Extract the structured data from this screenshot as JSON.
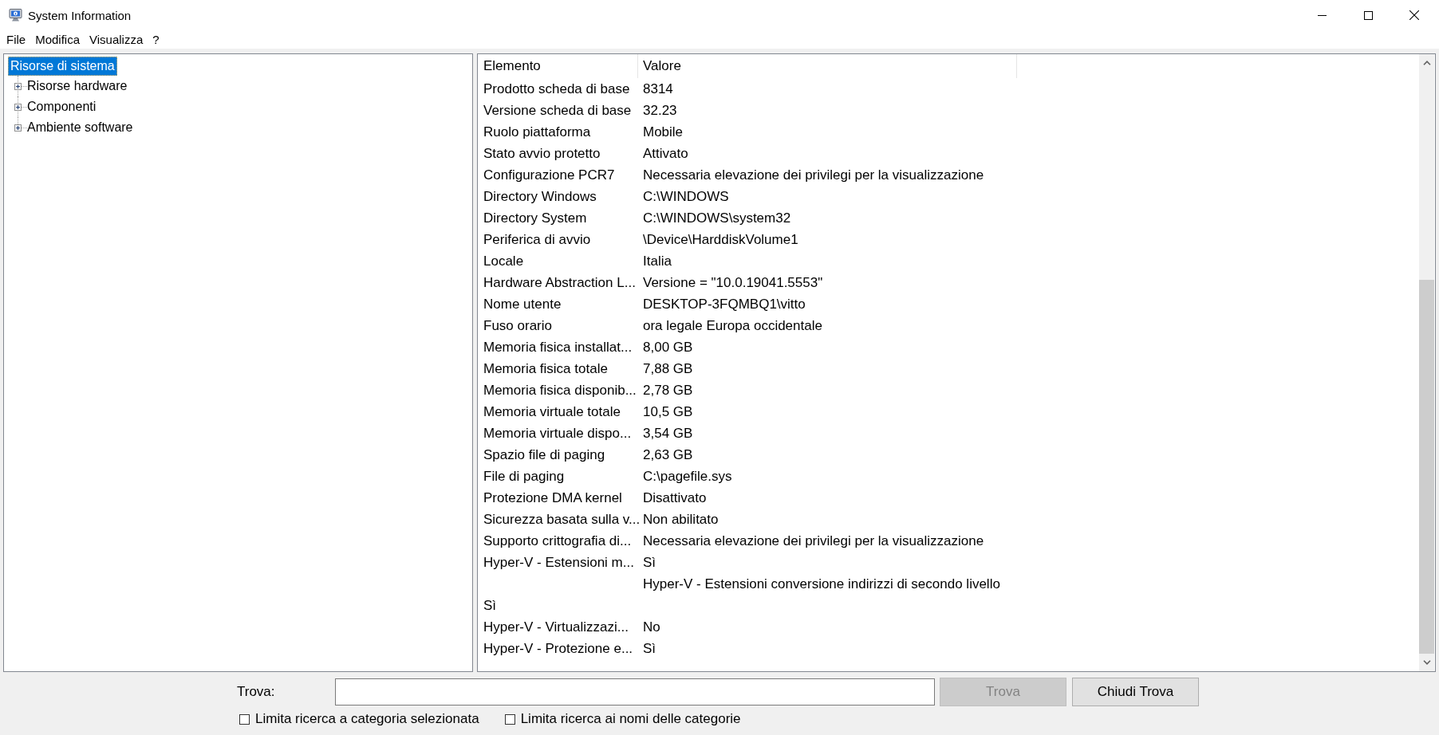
{
  "window": {
    "title": "System Information"
  },
  "menu": [
    "File",
    "Modifica",
    "Visualizza",
    "?"
  ],
  "tree": {
    "label": "Risorse di sistema",
    "selected": true,
    "children": [
      {
        "label": "Risorse hardware",
        "expanded": false,
        "selected": false
      },
      {
        "label": "Componenti",
        "expanded": false,
        "selected": false
      },
      {
        "label": "Ambiente software",
        "expanded": false,
        "selected": false
      }
    ]
  },
  "table": {
    "columns": [
      "Elemento",
      "Valore"
    ],
    "rows": [
      {
        "element": "Prodotto scheda di base",
        "value": "8314"
      },
      {
        "element": "Versione scheda di base",
        "value": "32.23"
      },
      {
        "element": "Ruolo piattaforma",
        "value": "Mobile"
      },
      {
        "element": "Stato avvio protetto",
        "value": "Attivato"
      },
      {
        "element": "Configurazione PCR7",
        "value": "Necessaria elevazione dei privilegi per la visualizzazione"
      },
      {
        "element": "Directory Windows",
        "value": "C:\\WINDOWS"
      },
      {
        "element": "Directory System",
        "value": "C:\\WINDOWS\\system32"
      },
      {
        "element": "Periferica di avvio",
        "value": "\\Device\\HarddiskVolume1"
      },
      {
        "element": "Locale",
        "value": "Italia"
      },
      {
        "element": "Hardware Abstraction L...",
        "value": "Versione = \"10.0.19041.5553\""
      },
      {
        "element": "Nome utente",
        "value": "DESKTOP-3FQMBQ1\\vitto"
      },
      {
        "element": "Fuso orario",
        "value": "ora legale Europa occidentale"
      },
      {
        "element": "Memoria fisica installat...",
        "value": "8,00 GB"
      },
      {
        "element": "Memoria fisica totale",
        "value": "7,88 GB"
      },
      {
        "element": "Memoria fisica disponib...",
        "value": "2,78 GB"
      },
      {
        "element": "Memoria virtuale totale",
        "value": "10,5 GB"
      },
      {
        "element": "Memoria virtuale dispo...",
        "value": "3,54 GB"
      },
      {
        "element": "Spazio file di paging",
        "value": "2,63 GB"
      },
      {
        "element": "File di paging",
        "value": "C:\\pagefile.sys"
      },
      {
        "element": "Protezione DMA kernel",
        "value": "Disattivato"
      },
      {
        "element": "Sicurezza basata sulla v...",
        "value": "Non abilitato"
      },
      {
        "element": "Supporto crittografia di...",
        "value": "Necessaria elevazione dei privilegi per la visualizzazione"
      },
      {
        "element": "Hyper-V - Estensioni m...",
        "value": "Sì"
      },
      {
        "value": "Hyper-V - Estensioni conversione indirizzi di secondo livello"
      },
      {
        "element": "Sì"
      },
      {
        "element": "Hyper-V - Virtualizzazi...",
        "value": "No"
      },
      {
        "element": "Hyper-V - Protezione e...",
        "value": "Sì"
      }
    ]
  },
  "find_bar": {
    "label": "Trova:",
    "buttons": [
      {
        "label": "Trova",
        "disabled": true
      },
      {
        "label": "Chiudi Trova",
        "disabled": false
      }
    ],
    "options": [
      {
        "label": "Limita ricerca a categoria selezionata",
        "checked": false
      },
      {
        "label": "Limita ricerca ai nomi delle categorie",
        "checked": false
      }
    ]
  }
}
